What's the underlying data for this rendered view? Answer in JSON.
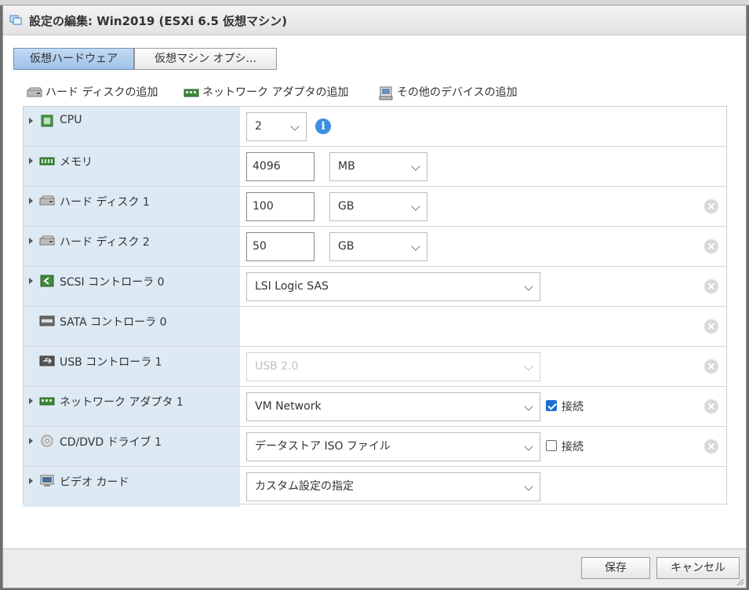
{
  "dialog": {
    "title": "設定の編集: Win2019 (ESXi 6.5 仮想マシン)"
  },
  "tabs": [
    {
      "label": "仮想ハードウェア",
      "active": true
    },
    {
      "label": "仮想マシン オプシ...",
      "active": false
    }
  ],
  "toolbar": {
    "add_disk": "ハード ディスクの追加",
    "add_nic": "ネットワーク アダプタの追加",
    "add_other": "その他のデバイスの追加"
  },
  "rows": {
    "cpu": {
      "label": "CPU",
      "value": "2",
      "info": "i"
    },
    "memory": {
      "label": "メモリ",
      "value": "4096",
      "unit": "MB"
    },
    "disk1": {
      "label": "ハード ディスク 1",
      "value": "100",
      "unit": "GB"
    },
    "disk2": {
      "label": "ハード ディスク 2",
      "value": "50",
      "unit": "GB"
    },
    "scsi": {
      "label": "SCSI コントローラ 0",
      "value": "LSI Logic SAS"
    },
    "sata": {
      "label": "SATA コントローラ 0"
    },
    "usb": {
      "label": "USB コントローラ 1",
      "value": "USB 2.0"
    },
    "nic": {
      "label": "ネットワーク アダプタ 1",
      "value": "VM Network",
      "connect_label": "接続",
      "connected": true
    },
    "cd": {
      "label": "CD/DVD ドライブ 1",
      "value": "データストア ISO ファイル",
      "connect_label": "接続",
      "connected": false
    },
    "video": {
      "label": "ビデオ カード",
      "value": "カスタム設定の指定"
    }
  },
  "footer": {
    "save": "保存",
    "cancel": "キャンセル"
  },
  "colors": {
    "label_bg": "#dde9f3",
    "tab_active": "#b5d1f0",
    "checkbox_on": "#1a6fd0",
    "info": "#3d8ee0"
  }
}
